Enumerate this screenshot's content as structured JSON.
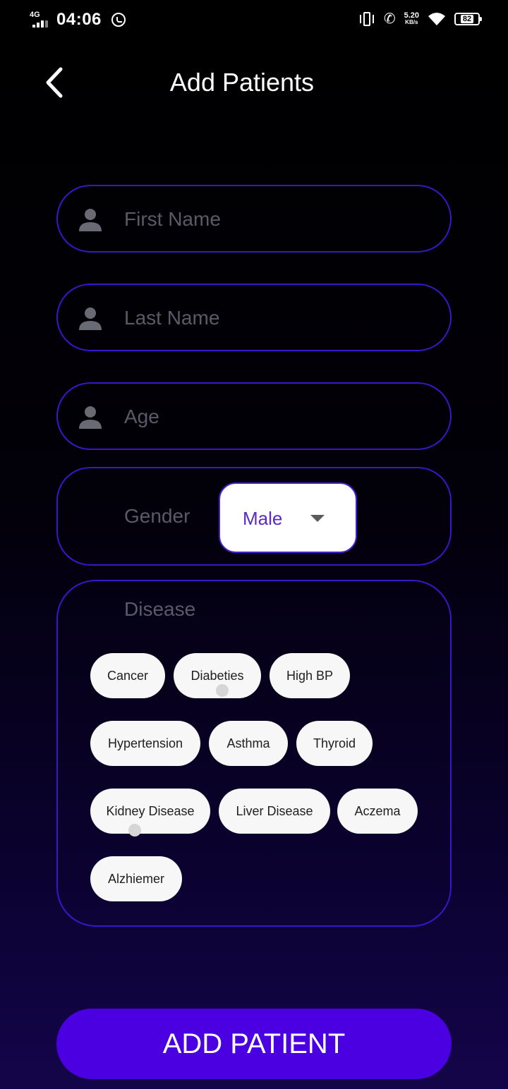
{
  "status_bar": {
    "network": "4G",
    "time": "04:06",
    "speed_value": "5.20",
    "speed_unit": "KB/s",
    "battery": "82"
  },
  "header": {
    "title": "Add Patients"
  },
  "form": {
    "first_name": {
      "placeholder": "First Name",
      "value": ""
    },
    "last_name": {
      "placeholder": "Last Name",
      "value": ""
    },
    "age": {
      "placeholder": "Age",
      "value": ""
    },
    "gender": {
      "label": "Gender",
      "selected": "Male"
    },
    "disease": {
      "label": "Disease",
      "chips": [
        "Cancer",
        "Diabeties",
        "High BP",
        "Hypertension",
        "Asthma",
        "Thyroid",
        "Kidney Disease",
        "Liver Disease",
        "Aczema",
        "Alzhiemer"
      ]
    }
  },
  "actions": {
    "add_label": "ADD PATIENT"
  },
  "colors": {
    "accent": "#4a00e0",
    "border": "#3a16c9",
    "placeholder": "#5a5a68",
    "selected_text": "#5a2bbf"
  }
}
